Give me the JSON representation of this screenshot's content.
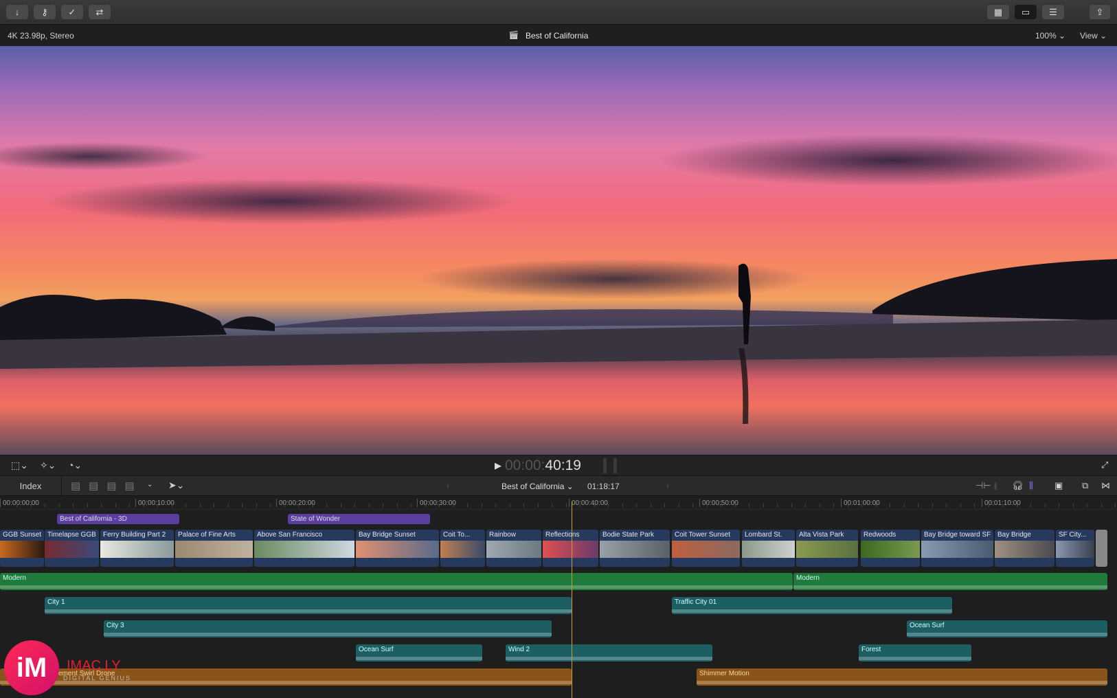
{
  "toolbar": {
    "buttons": [
      "import",
      "keywords",
      "background-tasks",
      "roles"
    ],
    "right": [
      "browser",
      "timeline",
      "inspector",
      "share"
    ]
  },
  "viewer": {
    "format": "4K 23.98p, Stereo",
    "title": "Best of California",
    "zoom": "100%",
    "view": "View",
    "timecode_dim": "00:00:",
    "timecode": "40:19"
  },
  "timeline": {
    "index": "Index",
    "project": "Best of California",
    "duration": "01:18:17",
    "ruler": [
      "00:00:00:00",
      "00:00:10:00",
      "00:00:20:00",
      "00:00:30:00",
      "00:00:40:00",
      "00:00:50:00",
      "00:01:00:00",
      "00:01:10:00"
    ],
    "titles": [
      "Best of California - 3D",
      "State of Wonder"
    ],
    "primary": [
      "GGB Sunset",
      "Timelapse GGB",
      "Ferry Building Part 2",
      "Palace of Fine Arts",
      "Above San Francisco",
      "Bay Bridge Sunset",
      "Coit To...",
      "Rainbow",
      "Reflections",
      "Bodie State Park",
      "Coit Tower Sunset",
      "Lombard St.",
      "Alta Vista Park",
      "Redwoods",
      "Bay Bridge toward SF",
      "Bay Bridge",
      "SF City..."
    ],
    "audio": [
      "Modern",
      "Modern",
      "City 1",
      "Traffic City 01",
      "City 3",
      "Ocean Surf",
      "Ocean Surf",
      "Wind 2",
      "Forest",
      "vement Swirl Drone",
      "Shimmer Motion"
    ]
  },
  "watermark": {
    "logo": "iM",
    "brand": "IMAC.LY",
    "tagline": "DIGITAL GENIUS"
  },
  "colors": {
    "title": "#5a3fa0",
    "primary": "#253a5e",
    "music": "#1f7a3c",
    "effects": "#1d5e63",
    "dialogue": "#8a5418",
    "playhead": "#c9a030"
  }
}
